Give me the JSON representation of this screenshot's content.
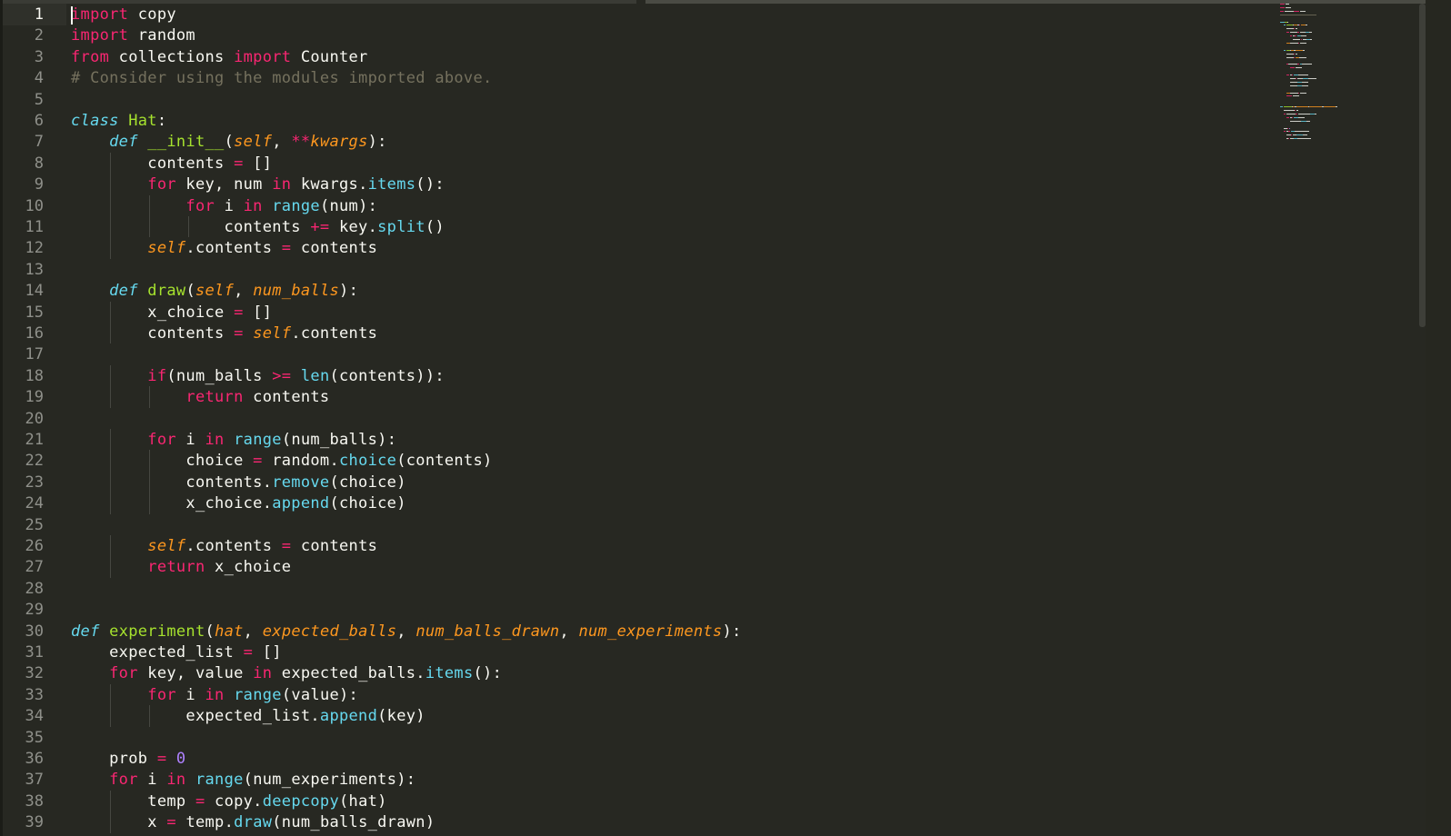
{
  "editor": {
    "first_line_number": 1,
    "colors": {
      "background": "#272822",
      "keyword": "#f92672",
      "storage": "#66d9ef",
      "function_name": "#a6e22e",
      "class_name": "#a6e22e",
      "parameter": "#fd971f",
      "builtin": "#66d9ef",
      "number": "#ae81ff",
      "comment": "#75715e",
      "text": "#f8f8f2"
    },
    "lines": [
      [
        [
          "k",
          "import"
        ],
        [
          "t",
          " copy"
        ]
      ],
      [
        [
          "k",
          "import"
        ],
        [
          "t",
          " random"
        ]
      ],
      [
        [
          "k",
          "from"
        ],
        [
          "t",
          " collections "
        ],
        [
          "k",
          "import"
        ],
        [
          "t",
          " Counter"
        ]
      ],
      [
        [
          "c",
          "# Consider using the modules imported above."
        ]
      ],
      [],
      [
        [
          "s",
          "class"
        ],
        [
          "t",
          " "
        ],
        [
          "f",
          "Hat"
        ],
        [
          "t",
          ":"
        ]
      ],
      [
        [
          "t",
          "    "
        ],
        [
          "s",
          "def"
        ],
        [
          "t",
          " "
        ],
        [
          "f",
          "__init__"
        ],
        [
          "t",
          "("
        ],
        [
          "p",
          "self"
        ],
        [
          "t",
          ", "
        ],
        [
          "k",
          "**"
        ],
        [
          "p",
          "kwargs"
        ],
        [
          "t",
          "):"
        ]
      ],
      [
        [
          "t",
          "        contents "
        ],
        [
          "k",
          "="
        ],
        [
          "t",
          " []"
        ]
      ],
      [
        [
          "t",
          "        "
        ],
        [
          "k",
          "for"
        ],
        [
          "t",
          " key, num "
        ],
        [
          "k",
          "in"
        ],
        [
          "t",
          " kwargs."
        ],
        [
          "b",
          "items"
        ],
        [
          "t",
          "():"
        ]
      ],
      [
        [
          "t",
          "            "
        ],
        [
          "k",
          "for"
        ],
        [
          "t",
          " i "
        ],
        [
          "k",
          "in"
        ],
        [
          "t",
          " "
        ],
        [
          "b",
          "range"
        ],
        [
          "t",
          "(num):"
        ]
      ],
      [
        [
          "t",
          "                contents "
        ],
        [
          "k",
          "+="
        ],
        [
          "t",
          " key."
        ],
        [
          "b",
          "split"
        ],
        [
          "t",
          "()"
        ]
      ],
      [
        [
          "t",
          "        "
        ],
        [
          "p",
          "self"
        ],
        [
          "t",
          ".contents "
        ],
        [
          "k",
          "="
        ],
        [
          "t",
          " contents"
        ]
      ],
      [],
      [
        [
          "t",
          "    "
        ],
        [
          "s",
          "def"
        ],
        [
          "t",
          " "
        ],
        [
          "f",
          "draw"
        ],
        [
          "t",
          "("
        ],
        [
          "p",
          "self"
        ],
        [
          "t",
          ", "
        ],
        [
          "p",
          "num_balls"
        ],
        [
          "t",
          "):"
        ]
      ],
      [
        [
          "t",
          "        x_choice "
        ],
        [
          "k",
          "="
        ],
        [
          "t",
          " []"
        ]
      ],
      [
        [
          "t",
          "        contents "
        ],
        [
          "k",
          "="
        ],
        [
          "t",
          " "
        ],
        [
          "p",
          "self"
        ],
        [
          "t",
          ".contents"
        ]
      ],
      [],
      [
        [
          "t",
          "        "
        ],
        [
          "k",
          "if"
        ],
        [
          "t",
          "(num_balls "
        ],
        [
          "k",
          ">="
        ],
        [
          "t",
          " "
        ],
        [
          "b",
          "len"
        ],
        [
          "t",
          "(contents)):"
        ]
      ],
      [
        [
          "t",
          "            "
        ],
        [
          "k",
          "return"
        ],
        [
          "t",
          " contents"
        ]
      ],
      [],
      [
        [
          "t",
          "        "
        ],
        [
          "k",
          "for"
        ],
        [
          "t",
          " i "
        ],
        [
          "k",
          "in"
        ],
        [
          "t",
          " "
        ],
        [
          "b",
          "range"
        ],
        [
          "t",
          "(num_balls):"
        ]
      ],
      [
        [
          "t",
          "            choice "
        ],
        [
          "k",
          "="
        ],
        [
          "t",
          " random."
        ],
        [
          "b",
          "choice"
        ],
        [
          "t",
          "(contents)"
        ]
      ],
      [
        [
          "t",
          "            contents."
        ],
        [
          "b",
          "remove"
        ],
        [
          "t",
          "(choice)"
        ]
      ],
      [
        [
          "t",
          "            x_choice."
        ],
        [
          "b",
          "append"
        ],
        [
          "t",
          "(choice)"
        ]
      ],
      [],
      [
        [
          "t",
          "        "
        ],
        [
          "p",
          "self"
        ],
        [
          "t",
          ".contents "
        ],
        [
          "k",
          "="
        ],
        [
          "t",
          " contents"
        ]
      ],
      [
        [
          "t",
          "        "
        ],
        [
          "k",
          "return"
        ],
        [
          "t",
          " x_choice"
        ]
      ],
      [],
      [],
      [
        [
          "s",
          "def"
        ],
        [
          "t",
          " "
        ],
        [
          "f",
          "experiment"
        ],
        [
          "t",
          "("
        ],
        [
          "p",
          "hat"
        ],
        [
          "t",
          ", "
        ],
        [
          "p",
          "expected_balls"
        ],
        [
          "t",
          ", "
        ],
        [
          "p",
          "num_balls_drawn"
        ],
        [
          "t",
          ", "
        ],
        [
          "p",
          "num_experiments"
        ],
        [
          "t",
          "):"
        ]
      ],
      [
        [
          "t",
          "    expected_list "
        ],
        [
          "k",
          "="
        ],
        [
          "t",
          " []"
        ]
      ],
      [
        [
          "t",
          "    "
        ],
        [
          "k",
          "for"
        ],
        [
          "t",
          " key, value "
        ],
        [
          "k",
          "in"
        ],
        [
          "t",
          " expected_balls."
        ],
        [
          "b",
          "items"
        ],
        [
          "t",
          "():"
        ]
      ],
      [
        [
          "t",
          "        "
        ],
        [
          "k",
          "for"
        ],
        [
          "t",
          " i "
        ],
        [
          "k",
          "in"
        ],
        [
          "t",
          " "
        ],
        [
          "b",
          "range"
        ],
        [
          "t",
          "(value):"
        ]
      ],
      [
        [
          "t",
          "            expected_list."
        ],
        [
          "b",
          "append"
        ],
        [
          "t",
          "(key)"
        ]
      ],
      [],
      [
        [
          "t",
          "    prob "
        ],
        [
          "k",
          "="
        ],
        [
          "t",
          " "
        ],
        [
          "n",
          "0"
        ]
      ],
      [
        [
          "t",
          "    "
        ],
        [
          "k",
          "for"
        ],
        [
          "t",
          " i "
        ],
        [
          "k",
          "in"
        ],
        [
          "t",
          " "
        ],
        [
          "b",
          "range"
        ],
        [
          "t",
          "(num_experiments):"
        ]
      ],
      [
        [
          "t",
          "        temp "
        ],
        [
          "k",
          "="
        ],
        [
          "t",
          " copy."
        ],
        [
          "b",
          "deepcopy"
        ],
        [
          "t",
          "(hat)"
        ]
      ],
      [
        [
          "t",
          "        x "
        ],
        [
          "k",
          "="
        ],
        [
          "t",
          " temp."
        ],
        [
          "b",
          "draw"
        ],
        [
          "t",
          "(num_balls_drawn)"
        ]
      ]
    ]
  }
}
